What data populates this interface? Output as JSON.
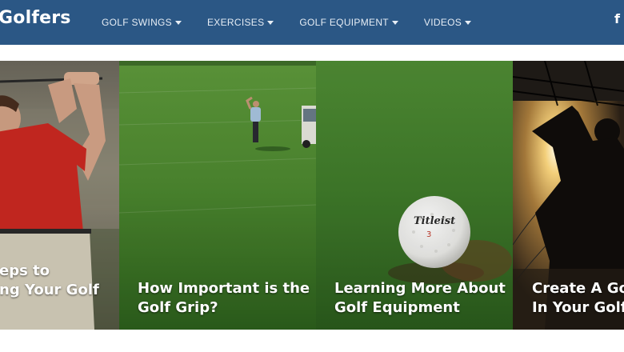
{
  "header": {
    "brand": "Golfers",
    "nav": [
      {
        "label": "GOLF SWINGS",
        "caret": true
      },
      {
        "label": "EXERCISES",
        "caret": true
      },
      {
        "label": "GOLF EQUIPMENT",
        "caret": true
      },
      {
        "label": "VIDEOS",
        "caret": true
      }
    ],
    "social_icon": "f",
    "colors": {
      "navbar": "#2b5785",
      "nav_text": "#e6edf5"
    }
  },
  "cards": [
    {
      "title_lines": [
        "eps to",
        "ng Your Golf"
      ],
      "image": "golfer-red-shirt-swing"
    },
    {
      "title_lines": [
        "How Important is the",
        "Golf Grip?"
      ],
      "image": "golfer-on-fairway"
    },
    {
      "title_lines": [
        "Learning More About",
        "Golf Equipment"
      ],
      "image": "titleist-golf-ball-on-grass"
    },
    {
      "title_lines": [
        "Create A Goo",
        "In Your Golf"
      ],
      "image": "golfer-silhouette-sunset"
    }
  ],
  "ball_brand": "Titleist",
  "ball_number": "3"
}
